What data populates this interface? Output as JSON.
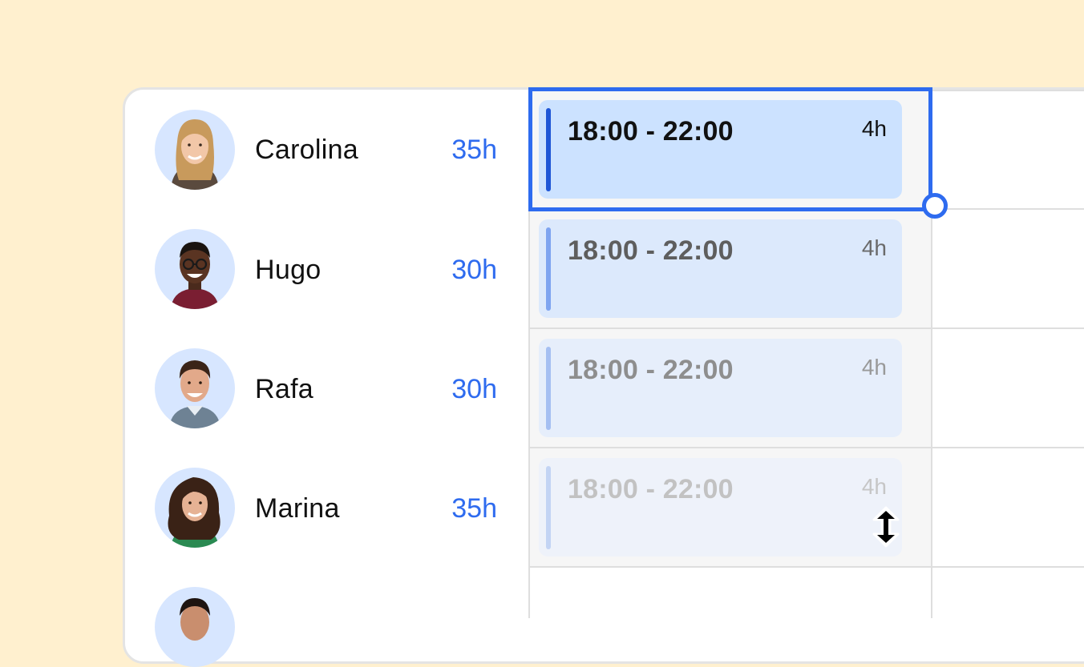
{
  "employees": [
    {
      "name": "Carolina",
      "hours": "35h",
      "avatar_icon": "woman-blonde-avatar-icon"
    },
    {
      "name": "Hugo",
      "hours": "30h",
      "avatar_icon": "man-glasses-avatar-icon"
    },
    {
      "name": "Rafa",
      "hours": "30h",
      "avatar_icon": "man-smiling-avatar-icon"
    },
    {
      "name": "Marina",
      "hours": "35h",
      "avatar_icon": "woman-curly-avatar-icon"
    },
    {
      "name": "",
      "hours": "",
      "avatar_icon": "man-partial-avatar-icon"
    }
  ],
  "shifts": [
    {
      "time": "18:00 - 22:00",
      "duration": "4h",
      "selected": true
    },
    {
      "time": "18:00 - 22:00",
      "duration": "4h",
      "selected": false
    },
    {
      "time": "18:00 - 22:00",
      "duration": "4h",
      "selected": false
    },
    {
      "time": "18:00 - 22:00",
      "duration": "4h",
      "selected": false
    }
  ],
  "colors": {
    "background": "#FFF0CF",
    "accent": "#2E6BEF",
    "hours_text": "#2E6BEF",
    "avatar_bg": "#D7E6FF",
    "selected_card": "#CCE2FF"
  },
  "cursor_icon": "resize-vertical-cursor-icon"
}
